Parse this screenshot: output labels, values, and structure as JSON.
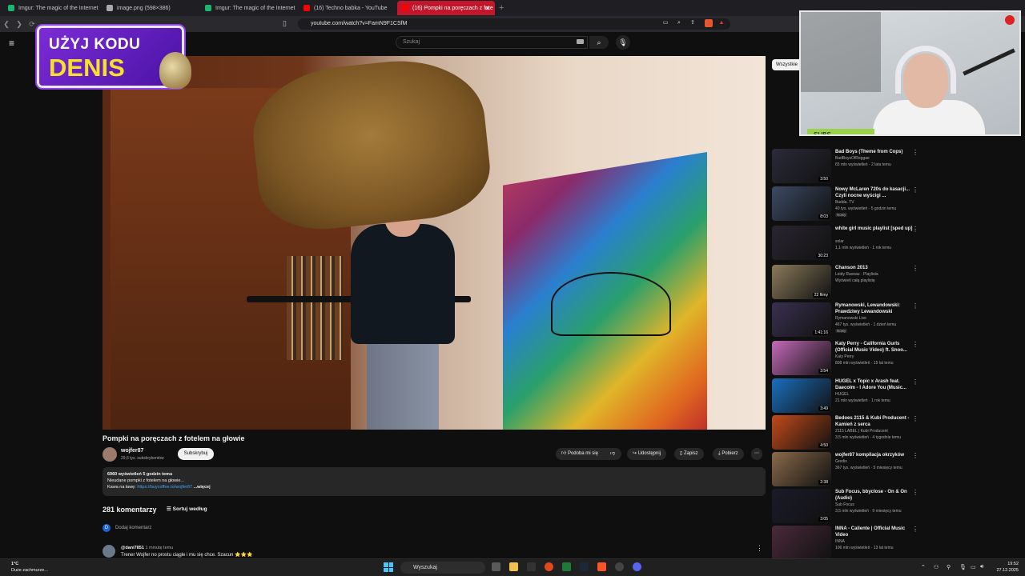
{
  "browser": {
    "tabs": [
      {
        "label": "Imgur: The magic of the Internet",
        "color": "#1bb76e",
        "active": false
      },
      {
        "label": "image.png (598×386)",
        "color": "#aaaaaa",
        "active": false
      },
      {
        "label": "Imgur: The magic of the Internet",
        "color": "#1bb76e",
        "active": false
      },
      {
        "label": "(16) Techno babka - YouTube",
        "color": "#ff0000",
        "active": false
      },
      {
        "label": "(16) Pompki na poręczach z fote",
        "color": "#ff0000",
        "active": true
      }
    ],
    "url": "youtube.com/watch?v=FamN9F1CSfM"
  },
  "youtube": {
    "search_placeholder": "Szukaj"
  },
  "promo": {
    "line1": "UŻYJ KODU",
    "line2": "DENIS"
  },
  "video": {
    "title": "Pompki na poręczach z fotelem na głowie",
    "channel": "wojfer87",
    "subscribers": "29,6 tys. subskrybentów",
    "subscribe_label": "Subskrybuj",
    "actions": {
      "like": "Podoba mi się",
      "share": "Udostępnij",
      "save": "Zapisz",
      "download": "Pobierz"
    },
    "description": {
      "stats": "6960 wyświetleń  5 godzin temu",
      "line2": "Nieudane pompki z fotelem na głowie...",
      "line3_prefix": "Kawa na ławę: ",
      "link": "https://buycoffee.to/wojfer87",
      "more": " ...więcej"
    }
  },
  "comments": {
    "count": "281 komentarzy",
    "sort_label": "Sortuj według",
    "add_placeholder": "Dodaj komentarz",
    "add_avatar": "D",
    "first": {
      "user": "@dani7851",
      "time": "1 minutę temu",
      "text": "Trener Wojfer no prostu ciągle i mu się chce. Szacun ⭐⭐⭐"
    }
  },
  "sidebar": {
    "chip": "Wszystkie",
    "items": [
      {
        "title": "Bad Boys (Theme from Cops)",
        "meta1": "BadBoysOfReggae",
        "meta2": "65 mln wyświetleń · 2 lata temu",
        "duration": "3:50",
        "badge": "",
        "thumb": "#2b2b3a"
      },
      {
        "title": "Nowy McLaren 720s do kasacji... Czyli nocne wyścigi ...",
        "meta1": "Budda. TV",
        "meta2": "40 tys. wyświetleń · 5 godzin temu",
        "duration": "8:03",
        "badge": "Nowy",
        "thumb": "#3b4a63"
      },
      {
        "title": "white girl music playlist [sped up]",
        "meta1": "solar",
        "meta2": "1,1 mln wyświetleń · 1 rok temu",
        "duration": "30:23",
        "badge": "",
        "thumb": "#2a2530"
      },
      {
        "title": "Chanson 2013",
        "meta1": "Leidy Raveau · Playlista",
        "meta2": "Wyświetl całą playlistę",
        "duration": "22 filmy",
        "badge": "",
        "thumb": "#8a7a5a"
      },
      {
        "title": "Rymanowski, Lewandowski: Prawdziwy Lewandowski",
        "meta1": "Rymanowski Live",
        "meta2": "467 tys. wyświetleń · 1 dzień temu",
        "duration": "1:41:16",
        "badge": "Nowy",
        "thumb": "#3a3050"
      },
      {
        "title": "Katy Perry - California Gurls (Official Music Video) ft. Snoo...",
        "meta1": "Katy Perry",
        "meta2": "808 mln wyświetleń · 15 lat temu",
        "duration": "3:54",
        "badge": "",
        "thumb": "#c46ab8"
      },
      {
        "title": "HUGEL x Topic x Arash feat. Daecolm - I Adore You (Music...",
        "meta1": "HUGEL",
        "meta2": "21 mln wyświetleń · 1 rok temu",
        "duration": "3:49",
        "badge": "",
        "thumb": "#1a6fbf"
      },
      {
        "title": "Bedoes 2115 & Kubi Producent - Kamień z serca",
        "meta1": "2115 LABEL | Kubi Producent",
        "meta2": "3,5 mln wyświetleń · 4 tygodnie temu",
        "duration": "4:50",
        "badge": "",
        "thumb": "#c24a1a"
      },
      {
        "title": "wojfer87 kompilacja okrzyków",
        "meta1": "Gredix",
        "meta2": "367 tys. wyświetleń · 5 miesięcy temu",
        "duration": "2:38",
        "badge": "",
        "thumb": "#8a6a4a"
      },
      {
        "title": "Sub Focus, bbyclose - On & On (Audio)",
        "meta1": "Sub Focus",
        "meta2": "3,5 mln wyświetleń · 9 miesięcy temu",
        "duration": "3:05",
        "badge": "",
        "thumb": "#1b1b2a"
      },
      {
        "title": "INNA - Caliente | Official Music Video",
        "meta1": "INNA",
        "meta2": "106 mln wyświetleń · 13 lat temu",
        "duration": "",
        "badge": "",
        "thumb": "#4a2a3a"
      }
    ]
  },
  "webcam": {
    "subs_label": "SUBS"
  },
  "taskbar": {
    "temp": "1°C",
    "weather": "Duże zachmurze...",
    "search": "Wyszukaj",
    "time": "19:52",
    "date": "27.12.2025"
  }
}
